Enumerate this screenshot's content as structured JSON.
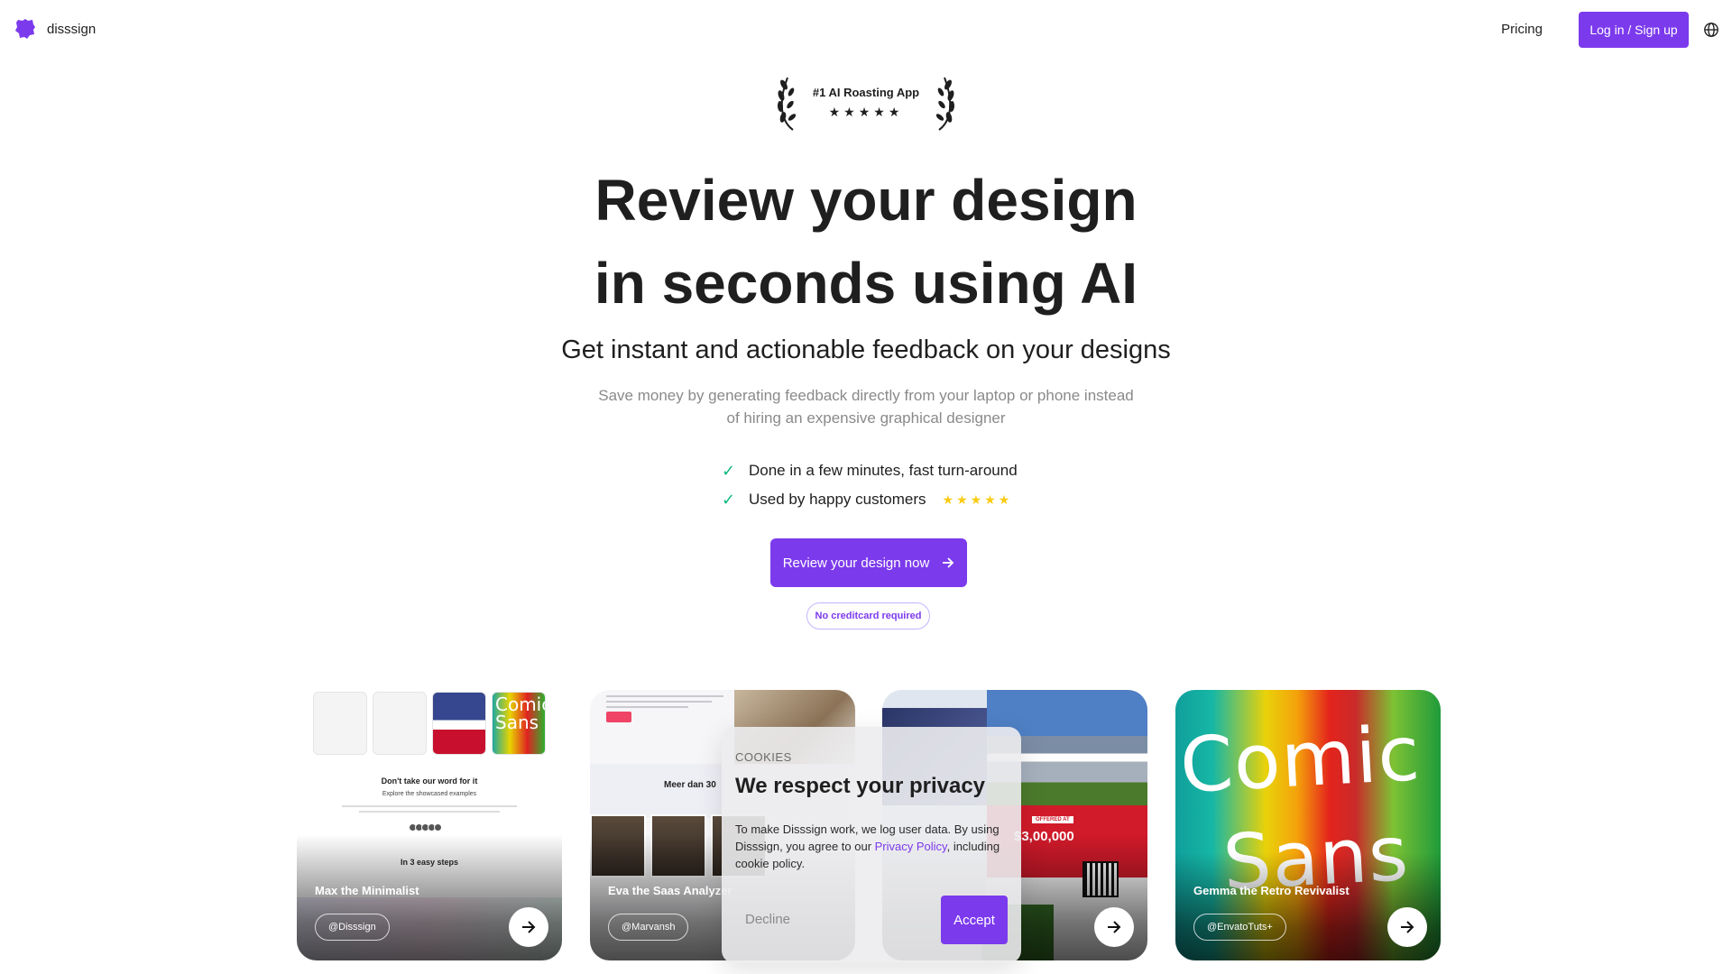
{
  "header": {
    "brand": "disssign",
    "pricing": "Pricing",
    "login": "Log in / Sign up",
    "brand_color": "#7c3aed"
  },
  "award": {
    "text": "#1 AI Roasting App",
    "stars": "★★★★★"
  },
  "hero": {
    "title_line1": "Review your design",
    "title_line2": "in seconds using AI",
    "subtitle": "Get instant and actionable feedback on your designs",
    "desc_line1": "Save money by generating feedback directly from your laptop or phone instead",
    "desc_line2": "of hiring an expensive graphical designer"
  },
  "features": [
    {
      "text": "Done in a few minutes, fast turn-around"
    },
    {
      "text": "Used by happy customers",
      "stars": "★★★★★"
    }
  ],
  "cta": {
    "label": "Review your design now",
    "badge": "No creditcard required"
  },
  "cards": [
    {
      "name": "Max the Minimalist",
      "tag": "@Disssign",
      "preview": {
        "heading": "Don't take our word for it",
        "sub": "Explore the showcased examples",
        "steps": "In 3 easy steps",
        "mini_text": "Comic Sans"
      }
    },
    {
      "name": "Eva the Saas Analyzer",
      "tag": "@Marvansh",
      "preview": {
        "title": "Meer dan 30"
      }
    },
    {
      "name": "",
      "tag": "",
      "preview": {
        "offered": "OFFERED AT",
        "price": "$3,00,000"
      }
    },
    {
      "name": "Gemma the Retro Revivalist",
      "tag": "@EnvatoTuts+",
      "preview": {
        "comic_line1": "Comic",
        "comic_line2": "Sans"
      }
    }
  ],
  "cookie": {
    "label": "COOKIES",
    "title": "We respect your privacy",
    "body_before": "To make Disssign work, we log user data. By using Disssign, you agree to our ",
    "link": "Privacy Policy",
    "body_after": ", including cookie policy.",
    "decline": "Decline",
    "accept": "Accept"
  }
}
